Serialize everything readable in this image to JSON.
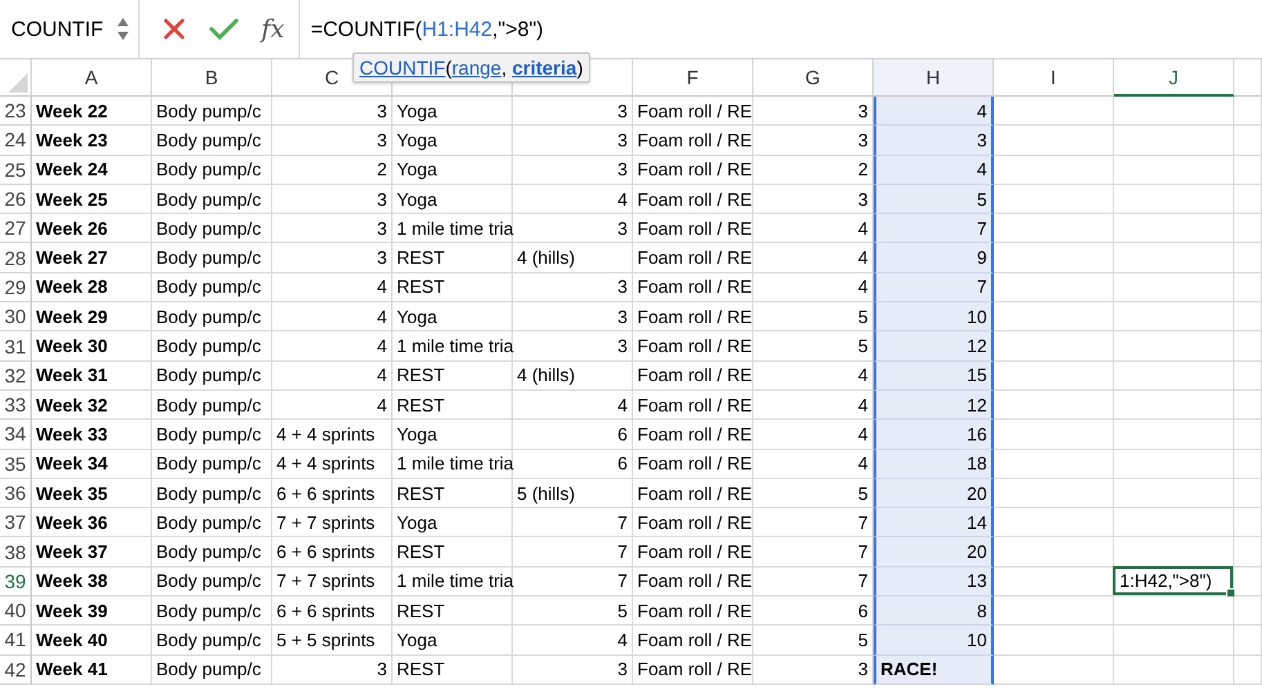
{
  "name_box": "COUNTIF",
  "fx_label": "fx",
  "formula": [
    {
      "text": "=COUNTIF("
    },
    {
      "text": "H1:H42",
      "kind": "range"
    },
    {
      "text": ",\">8\")"
    }
  ],
  "tooltip": [
    {
      "text": "COUNTIF",
      "kind": "link"
    },
    {
      "text": "("
    },
    {
      "text": "range",
      "kind": "link"
    },
    {
      "text": ", "
    },
    {
      "text": "criteria",
      "kind": "strong-link"
    },
    {
      "text": ")"
    }
  ],
  "columns": [
    {
      "label": "A",
      "selected": false,
      "active": false
    },
    {
      "label": "B",
      "selected": false,
      "active": false
    },
    {
      "label": "C",
      "selected": false,
      "active": false
    },
    {
      "selected": false,
      "active": false
    },
    {
      "selected": false,
      "active": false
    },
    {
      "label": "F",
      "selected": false,
      "active": false
    },
    {
      "label": "G",
      "selected": false,
      "active": false
    },
    {
      "label": "H",
      "selected": true,
      "active": false
    },
    {
      "label": "I",
      "selected": false,
      "active": false
    },
    {
      "label": "J",
      "selected": false,
      "active": true
    }
  ],
  "rows": [
    {
      "header": "23",
      "active": false,
      "cells": [
        "Week 22",
        "Body pump/c",
        {
          "number": "3"
        },
        "Yoga",
        {
          "number": "3"
        },
        "Foam roll / RE",
        {
          "number": "3"
        },
        {
          "number": "4"
        }
      ]
    },
    {
      "header": "24",
      "active": false,
      "cells": [
        "Week 23",
        "Body pump/c",
        {
          "number": "3"
        },
        "Yoga",
        {
          "number": "3"
        },
        "Foam roll / RE",
        {
          "number": "3"
        },
        {
          "number": "3"
        }
      ]
    },
    {
      "header": "25",
      "active": false,
      "cells": [
        "Week 24",
        "Body pump/c",
        {
          "number": "2"
        },
        "Yoga",
        {
          "number": "3"
        },
        "Foam roll / RE",
        {
          "number": "2"
        },
        {
          "number": "4"
        }
      ]
    },
    {
      "header": "26",
      "active": false,
      "cells": [
        "Week 25",
        "Body pump/c",
        {
          "number": "3"
        },
        "Yoga",
        {
          "number": "4"
        },
        "Foam roll / RE",
        {
          "number": "3"
        },
        {
          "number": "5"
        }
      ]
    },
    {
      "header": "27",
      "active": false,
      "cells": [
        "Week 26",
        "Body pump/c",
        {
          "number": "3"
        },
        "1 mile time tria",
        {
          "number": "3"
        },
        "Foam roll / RE",
        {
          "number": "4"
        },
        {
          "number": "7"
        }
      ]
    },
    {
      "header": "28",
      "active": false,
      "cells": [
        "Week 27",
        "Body pump/c",
        {
          "number": "3"
        },
        "REST",
        "4 (hills)",
        "Foam roll / RE",
        {
          "number": "4"
        },
        {
          "number": "9"
        }
      ]
    },
    {
      "header": "29",
      "active": false,
      "cells": [
        "Week 28",
        "Body pump/c",
        {
          "number": "4"
        },
        "REST",
        {
          "number": "3"
        },
        "Foam roll / RE",
        {
          "number": "4"
        },
        {
          "number": "7"
        }
      ]
    },
    {
      "header": "30",
      "active": false,
      "cells": [
        "Week 29",
        "Body pump/c",
        {
          "number": "4"
        },
        "Yoga",
        {
          "number": "3"
        },
        "Foam roll / RE",
        {
          "number": "5"
        },
        {
          "number": "10"
        }
      ]
    },
    {
      "header": "31",
      "active": false,
      "cells": [
        "Week 30",
        "Body pump/c",
        {
          "number": "4"
        },
        "1 mile time tria",
        {
          "number": "3"
        },
        "Foam roll / RE",
        {
          "number": "5"
        },
        {
          "number": "12"
        }
      ]
    },
    {
      "header": "32",
      "active": false,
      "cells": [
        "Week 31",
        "Body pump/c",
        {
          "number": "4"
        },
        "REST",
        "4 (hills)",
        "Foam roll / RE",
        {
          "number": "4"
        },
        {
          "number": "15"
        }
      ]
    },
    {
      "header": "33",
      "active": false,
      "cells": [
        "Week 32",
        "Body pump/c",
        {
          "number": "4"
        },
        "REST",
        {
          "number": "4"
        },
        "Foam roll / RE",
        {
          "number": "4"
        },
        {
          "number": "12"
        }
      ]
    },
    {
      "header": "34",
      "active": false,
      "cells": [
        "Week 33",
        "Body pump/c",
        "4 + 4 sprints",
        "Yoga",
        {
          "number": "6"
        },
        "Foam roll / RE",
        {
          "number": "4"
        },
        {
          "number": "16"
        }
      ]
    },
    {
      "header": "35",
      "active": false,
      "cells": [
        "Week 34",
        "Body pump/c",
        "4 + 4 sprints",
        "1 mile time tria",
        {
          "number": "6"
        },
        "Foam roll / RE",
        {
          "number": "4"
        },
        {
          "number": "18"
        }
      ]
    },
    {
      "header": "36",
      "active": false,
      "cells": [
        "Week 35",
        "Body pump/c",
        "6 + 6 sprints",
        "REST",
        "5 (hills)",
        "Foam roll / RE",
        {
          "number": "5"
        },
        {
          "number": "20"
        }
      ]
    },
    {
      "header": "37",
      "active": false,
      "cells": [
        "Week 36",
        "Body pump/c",
        "7 + 7 sprints",
        "Yoga",
        {
          "number": "7"
        },
        "Foam roll / RE",
        {
          "number": "7"
        },
        {
          "number": "14"
        }
      ]
    },
    {
      "header": "38",
      "active": false,
      "cells": [
        "Week 37",
        "Body pump/c",
        "6 + 6 sprints",
        "REST",
        {
          "number": "7"
        },
        "Foam roll / RE",
        {
          "number": "7"
        },
        {
          "number": "20"
        }
      ]
    },
    {
      "header": "39",
      "active": true,
      "active_cell_text": "1:H42,\">8\")",
      "cells": [
        "Week 38",
        "Body pump/c",
        "7 + 7 sprints",
        "1 mile time tria",
        {
          "number": "7"
        },
        "Foam roll / RE",
        {
          "number": "7"
        },
        {
          "number": "13"
        }
      ]
    },
    {
      "header": "40",
      "active": false,
      "cells": [
        "Week 39",
        "Body pump/c",
        "6 + 6 sprints",
        "REST",
        {
          "number": "5"
        },
        "Foam roll / RE",
        {
          "number": "6"
        },
        {
          "number": "8"
        }
      ]
    },
    {
      "header": "41",
      "active": false,
      "cells": [
        "Week 40",
        "Body pump/c",
        "5 + 5 sprints",
        "Yoga",
        {
          "number": "4"
        },
        "Foam roll / RE",
        {
          "number": "5"
        },
        {
          "number": "10"
        }
      ]
    },
    {
      "header": "42",
      "active": false,
      "cells": [
        "Week 41",
        "Body pump/c",
        {
          "number": "3"
        },
        "REST",
        {
          "number": "3"
        },
        "Foam roll / RE",
        {
          "number": "3"
        },
        {
          "text": "RACE!",
          "bold": true
        }
      ]
    }
  ]
}
